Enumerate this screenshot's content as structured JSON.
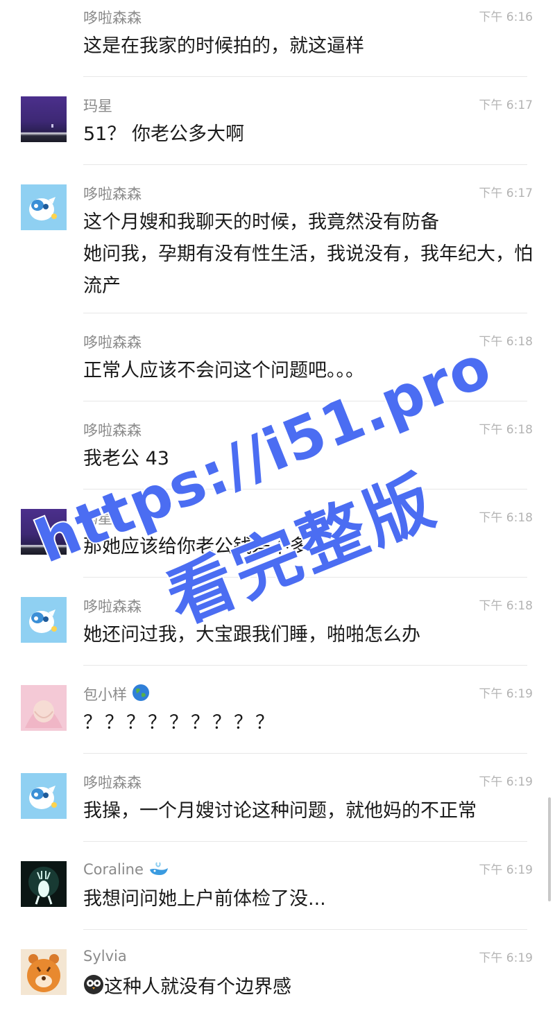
{
  "messages": [
    {
      "name": "哆啦森森",
      "time": "下午 6:16",
      "text": "这是在我家的时候拍的，就这逼样",
      "avatar": "none"
    },
    {
      "name": "玛星",
      "time": "下午 6:17",
      "text": "51？ 你老公多大啊",
      "avatar": "purple-sky-avatar"
    },
    {
      "name": "哆啦森森",
      "time": "下午 6:17",
      "text": "这个月嫂和我聊天的时候，我竟然没有防备\n她问我，孕期有没有性生活，我说没有，我年纪大，怕流产",
      "avatar": "cartoon-blue-avatar"
    },
    {
      "name": "哆啦森森",
      "time": "下午 6:18",
      "text": "正常人应该不会问这个问题吧。。。",
      "avatar": "none"
    },
    {
      "name": "哆啦森森",
      "time": "下午 6:18",
      "text": "我老公 43",
      "avatar": "none"
    },
    {
      "name": "玛星",
      "time": "下午 6:18",
      "text": "那她应该给你老公钱差不多",
      "avatar": "purple-sky-avatar"
    },
    {
      "name": "哆啦森森",
      "time": "下午 6:18",
      "text": "她还问过我，大宝跟我们睡，啪啪怎么办",
      "avatar": "cartoon-blue-avatar"
    },
    {
      "name": "包小样",
      "time": "下午 6:19",
      "text": "？？？？？？？？？",
      "avatar": "baby-photo-avatar",
      "name_icon": "globe-icon"
    },
    {
      "name": "哆啦森森",
      "time": "下午 6:19",
      "text": "我操，一个月嫂讨论这种问题，就他妈的不正常",
      "avatar": "cartoon-blue-avatar"
    },
    {
      "name": "Coraline",
      "time": "下午 6:19",
      "text": "我想问问她上户前体检了没...",
      "avatar": "deer-avatar",
      "name_icon": "whale-icon"
    },
    {
      "name": "Sylvia",
      "time": "下午 6:19",
      "text": "这种人就没有个边界感",
      "avatar": "tiger-avatar",
      "text_icon": "owl-icon"
    }
  ],
  "watermark": {
    "line1": "https://i51.pro",
    "line2": "看完整版",
    "color": "#4b6df2"
  },
  "colors": {
    "name": "#8a8a8a",
    "time": "#b3b3b3",
    "text": "#1a1a1a"
  }
}
